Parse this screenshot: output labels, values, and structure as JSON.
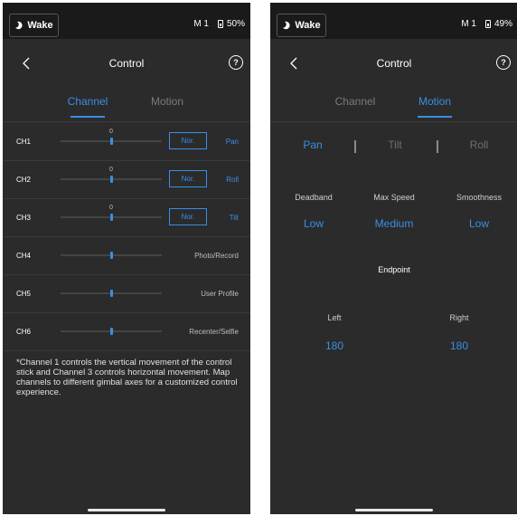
{
  "status": {
    "wake_label": "Wake",
    "mode": "M 1"
  },
  "left": {
    "battery": "50%",
    "title": "Control",
    "help": "?",
    "tabs": {
      "channel": "Channel",
      "motion": "Motion"
    },
    "channels": [
      {
        "label": "CH1",
        "value": "0",
        "mode": "Nor.",
        "function": "Pan"
      },
      {
        "label": "CH2",
        "value": "0",
        "mode": "Nor.",
        "function": "Roll"
      },
      {
        "label": "CH3",
        "value": "0",
        "mode": "Nor.",
        "function": "Tilt"
      },
      {
        "label": "CH4",
        "function": "Photo/Record"
      },
      {
        "label": "CH5",
        "function": "User Profile"
      },
      {
        "label": "CH6",
        "function": "Recenter/Selfie"
      }
    ],
    "footnote": "*Channel 1 controls the vertical movement of the control stick and Channel 3 controls horizontal movement. Map channels to different gimbal axes for a customized control experience."
  },
  "right": {
    "battery": "49%",
    "title": "Control",
    "help": "?",
    "tabs": {
      "channel": "Channel",
      "motion": "Motion"
    },
    "axes": {
      "pan": "Pan",
      "tilt": "Tilt",
      "roll": "Roll"
    },
    "params": {
      "deadband_label": "Deadband",
      "deadband_value": "Low",
      "maxspeed_label": "Max Speed",
      "maxspeed_value": "Medium",
      "smoothness_label": "Smoothness",
      "smoothness_value": "Low"
    },
    "endpoint": {
      "title": "Endpoint",
      "left_label": "Left",
      "left_value": "180",
      "right_label": "Right",
      "right_value": "180"
    }
  },
  "colors": {
    "accent": "#3a8ee6",
    "background": "#2b2b2b",
    "statusbar": "#1a1a1a"
  }
}
